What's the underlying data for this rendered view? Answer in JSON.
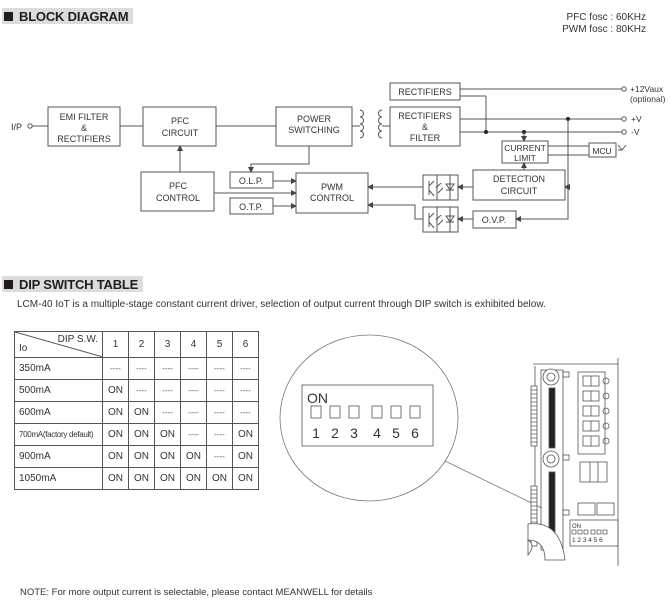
{
  "block_diagram": {
    "section_title": "BLOCK DIAGRAM",
    "fosc": {
      "pfc": "PFC fosc : 60KHz",
      "pwm": "PWM fosc : 80KHz"
    },
    "input_label": "I/P",
    "blocks": {
      "emi": [
        "EMI FILTER",
        "&",
        "RECTIFIERS"
      ],
      "pfc_circuit": [
        "PFC",
        "CIRCUIT"
      ],
      "power_switching": [
        "POWER",
        "SWITCHING"
      ],
      "rectifiers_aux": [
        "RECTIFIERS"
      ],
      "rectifiers_filter": [
        "RECTIFIERS",
        "&",
        "FILTER"
      ],
      "pfc_control": [
        "PFC",
        "CONTROL"
      ],
      "olp": [
        "O.L.P."
      ],
      "otp": [
        "O.T.P."
      ],
      "pwm_control": [
        "PWM",
        "CONTROL"
      ],
      "current_limit": [
        "CURRENT",
        "LIMIT"
      ],
      "mcu": [
        "MCU"
      ],
      "detection": [
        "DETECTION",
        "CIRCUIT"
      ],
      "ovp": [
        "O.V.P."
      ]
    },
    "outputs": {
      "aux": "+12Vaux",
      "aux_note": "(optional)",
      "pos": "+V",
      "neg": "-V"
    }
  },
  "dip_switch": {
    "section_title": "DIP SWITCH TABLE",
    "intro": "LCM-40 IoT is a multiple-stage constant current driver, selection of output current through DIP switch is exhibited below.",
    "table": {
      "corner_row_label": "Io",
      "corner_col_label": "DIP S.W.",
      "switch_numbers": [
        "1",
        "2",
        "3",
        "4",
        "5",
        "6"
      ],
      "rows": [
        {
          "io": "350mA",
          "cells": [
            "----",
            "----",
            "----",
            "----",
            "----",
            "----"
          ]
        },
        {
          "io": "500mA",
          "cells": [
            "ON",
            "----",
            "----",
            "----",
            "----",
            "----"
          ]
        },
        {
          "io": "600mA",
          "cells": [
            "ON",
            "ON",
            "----",
            "----",
            "----",
            "----"
          ]
        },
        {
          "io": "700mA(factory default)",
          "cells": [
            "ON",
            "ON",
            "ON",
            "----",
            "----",
            "ON"
          ]
        },
        {
          "io": "900mA",
          "cells": [
            "ON",
            "ON",
            "ON",
            "ON",
            "----",
            "ON"
          ]
        },
        {
          "io": "1050mA",
          "cells": [
            "ON",
            "ON",
            "ON",
            "ON",
            "ON",
            "ON"
          ]
        }
      ]
    },
    "zoom_detail": {
      "on_label": "ON",
      "numbers": [
        "1",
        "2",
        "3",
        "4",
        "5",
        "6"
      ]
    },
    "device_dip": {
      "on_label": "ON",
      "numbers": "1 2 3 4 5 6"
    }
  },
  "note": "NOTE: For more output current is selectable, please contact MEANWELL for details"
}
